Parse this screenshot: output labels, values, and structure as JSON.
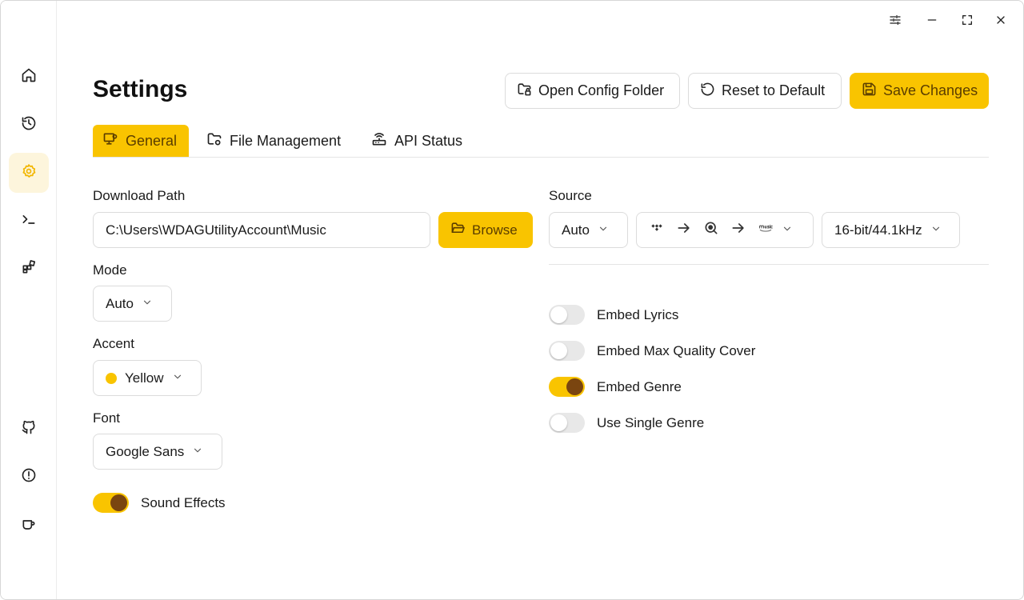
{
  "sidebar": {
    "items": [
      {
        "name": "home-icon"
      },
      {
        "name": "history-icon"
      },
      {
        "name": "settings-icon",
        "active": true
      },
      {
        "name": "terminal-icon"
      },
      {
        "name": "apps-icon"
      }
    ],
    "bottom": [
      {
        "name": "github-icon"
      },
      {
        "name": "alert-icon"
      },
      {
        "name": "coffee-icon"
      }
    ]
  },
  "titlebar": {
    "icons": [
      "sliders-icon",
      "minimize-icon",
      "maximize-icon",
      "close-icon"
    ]
  },
  "header": {
    "title": "Settings",
    "open_config_label": "Open Config Folder",
    "reset_label": "Reset to Default",
    "save_label": "Save Changes"
  },
  "tabs": [
    {
      "label": "General",
      "active": true
    },
    {
      "label": "File Management"
    },
    {
      "label": "API Status"
    }
  ],
  "general": {
    "download_path_label": "Download Path",
    "download_path_value": "C:\\Users\\WDAGUtilityAccount\\Music",
    "browse_label": "Browse",
    "mode_label": "Mode",
    "mode_value": "Auto",
    "accent_label": "Accent",
    "accent_value": "Yellow",
    "accent_color": "#f9c400",
    "font_label": "Font",
    "font_value": "Google Sans",
    "sound_effects_label": "Sound Effects",
    "sound_effects_on": true
  },
  "source": {
    "label": "Source",
    "auto_value": "Auto",
    "services": [
      "tidal-icon",
      "qobuz-icon",
      "amazon-music-icon"
    ],
    "quality_value": "16-bit/44.1kHz"
  },
  "toggles": [
    {
      "label": "Embed Lyrics",
      "on": false
    },
    {
      "label": "Embed Max Quality Cover",
      "on": false
    },
    {
      "label": "Embed Genre",
      "on": true
    },
    {
      "label": "Use Single Genre",
      "on": false
    }
  ],
  "colors": {
    "accent": "#f9c400",
    "accent_text": "#5a3d00",
    "knob_on": "#7a4510"
  }
}
